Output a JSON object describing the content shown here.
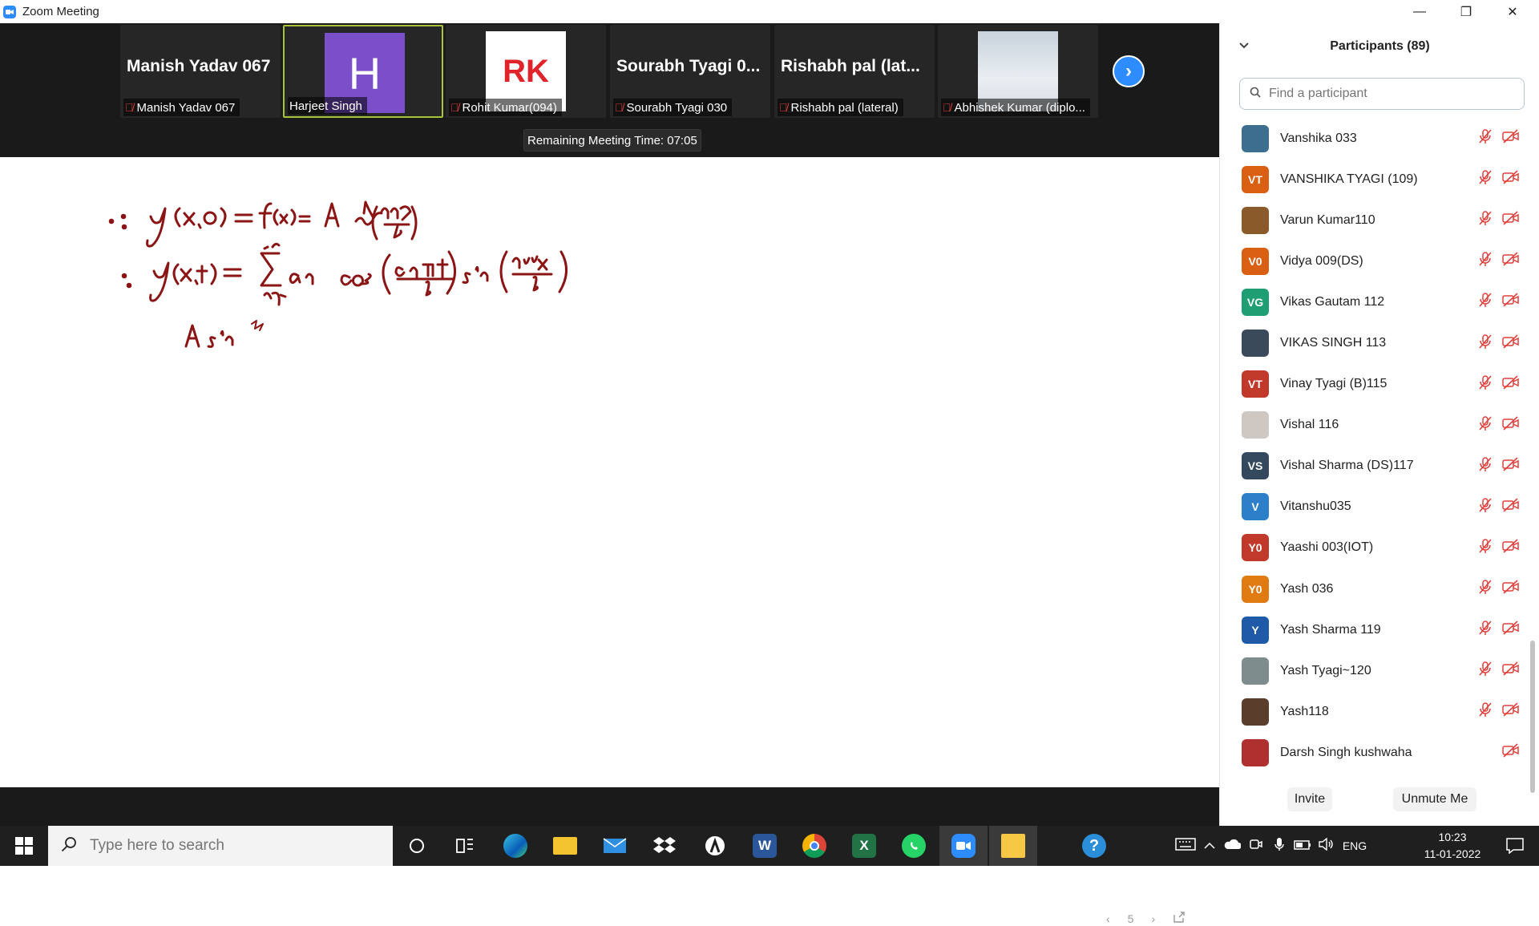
{
  "window": {
    "title": "Zoom Meeting",
    "minimize": "—",
    "restore": "❐",
    "close": "✕"
  },
  "video_strip": {
    "tiles": [
      {
        "big_name": "Manish Yadav 067",
        "label": "Manish Yadav 067",
        "muted": true
      },
      {
        "avatar_letter": "H",
        "label": "Harjeet Singh",
        "muted": false,
        "active": true
      },
      {
        "avatar_letters": "RK",
        "label": "Rohit Kumar(094)",
        "muted": true
      },
      {
        "big_name": "Sourabh Tyagi 0...",
        "label": "Sourabh Tyagi 030",
        "muted": true
      },
      {
        "big_name": "Rishabh pal (lat...",
        "label": "Rishabh pal (lateral)",
        "muted": true
      },
      {
        "label": "Abhishek Kumar (diplo...",
        "muted": true,
        "photo": true
      }
    ],
    "next_icon": "›",
    "remaining_time": "Remaining Meeting Time: 07:05"
  },
  "whiteboard": {
    "equations": [
      "∵ y(x,0) = f(x) = A sin(nπx/l)",
      "∵ y(x,t) = Σ(n=1→∞) aₙ cos(cnπt/l) sin(nπx/l)",
      "A sin"
    ],
    "page_number": "5",
    "prev": "‹",
    "next": "›"
  },
  "participants": {
    "title": "Participants (89)",
    "search_placeholder": "Find a participant",
    "items": [
      {
        "name": "Vanshika 033",
        "initials": "",
        "color": "#3b6e8f",
        "mic_muted": true,
        "video_off": true,
        "photo": true
      },
      {
        "name": "VANSHIKA TYAGI (109)",
        "initials": "VT",
        "color": "#d95f13",
        "mic_muted": true,
        "video_off": true
      },
      {
        "name": "Varun Kumar110",
        "initials": "",
        "color": "#8a5a2b",
        "mic_muted": true,
        "video_off": true,
        "photo": true
      },
      {
        "name": "Vidya 009(DS)",
        "initials": "V0",
        "color": "#d95f13",
        "mic_muted": true,
        "video_off": true
      },
      {
        "name": "Vikas Gautam 112",
        "initials": "VG",
        "color": "#1f9e74",
        "mic_muted": true,
        "video_off": true
      },
      {
        "name": "VIKAS SINGH 113",
        "initials": "",
        "color": "#3b4a5a",
        "mic_muted": true,
        "video_off": true,
        "photo": true
      },
      {
        "name": "Vinay Tyagi (B)115",
        "initials": "VT",
        "color": "#c0392b",
        "mic_muted": true,
        "video_off": true
      },
      {
        "name": "Vishal 116",
        "initials": "",
        "color": "#cfc7c2",
        "mic_muted": true,
        "video_off": true,
        "photo": true
      },
      {
        "name": "Vishal Sharma (DS)117",
        "initials": "VS",
        "color": "#34495e",
        "mic_muted": true,
        "video_off": true
      },
      {
        "name": "Vitanshu035",
        "initials": "V",
        "color": "#2d7fc9",
        "mic_muted": true,
        "video_off": true
      },
      {
        "name": "Yaashi 003(IOT)",
        "initials": "Y0",
        "color": "#c0392b",
        "mic_muted": true,
        "video_off": true
      },
      {
        "name": "Yash 036",
        "initials": "Y0",
        "color": "#e07b12",
        "mic_muted": true,
        "video_off": true
      },
      {
        "name": "Yash Sharma 119",
        "initials": "Y",
        "color": "#1e5aa8",
        "mic_muted": true,
        "video_off": true
      },
      {
        "name": "Yash Tyagi~120",
        "initials": "",
        "color": "#7f8c8d",
        "mic_muted": true,
        "video_off": true,
        "photo": true
      },
      {
        "name": "Yash118",
        "initials": "",
        "color": "#5a3d2b",
        "mic_muted": true,
        "video_off": true,
        "photo": true
      },
      {
        "name": "Darsh Singh kushwaha",
        "initials": "",
        "color": "#b03030",
        "mic_muted": false,
        "video_off": true,
        "photo": true
      }
    ],
    "invite_label": "Invite",
    "unmute_label": "Unmute Me"
  },
  "taskbar": {
    "search_placeholder": "Type here to search",
    "apps": [
      "cortana-icon",
      "task-view-icon",
      "edge-icon",
      "file-explorer-icon",
      "mail-icon",
      "dropbox-icon",
      "app-icon",
      "word-icon",
      "chrome-icon",
      "excel-icon",
      "whatsapp-icon",
      "zoom-icon",
      "sticky-notes-icon"
    ],
    "word_letter": "W",
    "excel_letter": "X",
    "help_icon": "?",
    "language": "ENG",
    "time": "10:23",
    "date": "11-01-2022"
  }
}
